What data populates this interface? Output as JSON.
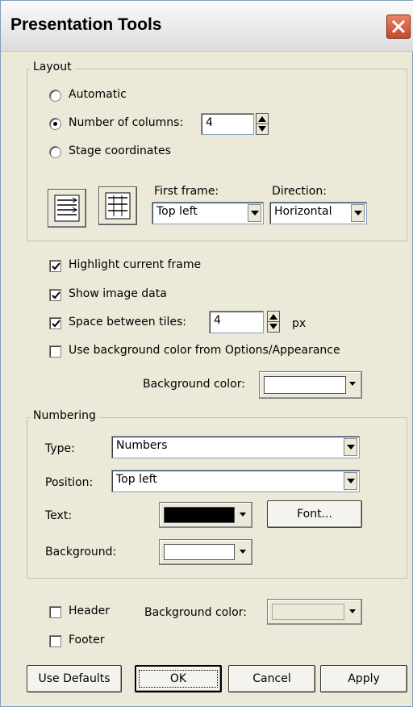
{
  "window": {
    "title": "Presentation Tools"
  },
  "layout": {
    "legend": "Layout",
    "radio_automatic": "Automatic",
    "radio_columns": "Number of columns:",
    "columns_value": "4",
    "radio_stage": "Stage coordinates",
    "selected": "columns",
    "first_frame_label": "First frame:",
    "first_frame_value": "Top left",
    "direction_label": "Direction:",
    "direction_value": "Horizontal"
  },
  "options": {
    "highlight_label": "Highlight current frame",
    "highlight_checked": true,
    "show_image_label": "Show image data",
    "show_image_checked": true,
    "space_label": "Space between tiles:",
    "space_checked": true,
    "space_value": "4",
    "space_unit": "px",
    "use_bg_label": "Use background color from Options/Appearance",
    "use_bg_checked": false,
    "bg_color_label": "Background color:",
    "bg_color": "#ffffff"
  },
  "numbering": {
    "legend": "Numbering",
    "type_label": "Type:",
    "type_value": "Numbers",
    "position_label": "Position:",
    "position_value": "Top left",
    "text_label": "Text:",
    "text_color": "#000000",
    "font_button": "Font...",
    "background_label": "Background:",
    "background_color": "#ffffff"
  },
  "header_footer": {
    "header_label": "Header",
    "header_checked": false,
    "footer_label": "Footer",
    "footer_checked": false,
    "bg_color_label": "Background color:",
    "bg_color": "#ece9d8"
  },
  "buttons": {
    "use_defaults": "Use Defaults",
    "ok": "OK",
    "cancel": "Cancel",
    "apply": "Apply"
  }
}
